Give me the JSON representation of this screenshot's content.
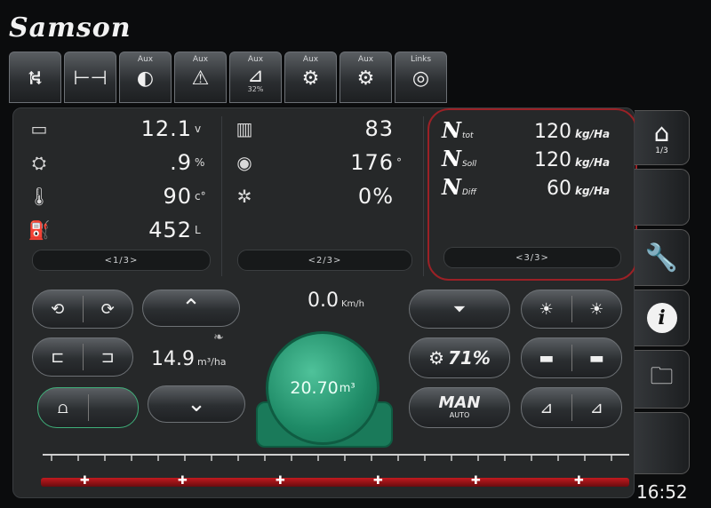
{
  "brand": "Samson",
  "tabs": [
    {
      "label": "",
      "icon": "lever-icon",
      "glyph": "⛕",
      "sub": ""
    },
    {
      "label": "",
      "icon": "axle-icon",
      "glyph": "⊢⊣",
      "sub": ""
    },
    {
      "label": "Aux",
      "icon": "light-icon",
      "glyph": "◐",
      "sub": ""
    },
    {
      "label": "Aux",
      "icon": "beacon-icon",
      "glyph": "⚠",
      "sub": ""
    },
    {
      "label": "Aux",
      "icon": "level-icon",
      "glyph": "⊿",
      "sub": "32%"
    },
    {
      "label": "Aux",
      "icon": "valve-icon",
      "glyph": "⚙",
      "sub": ""
    },
    {
      "label": "Aux",
      "icon": "pump-icon",
      "glyph": "⚙",
      "sub": ""
    },
    {
      "label": "Links",
      "icon": "tyre-icon",
      "glyph": "◎",
      "sub": ""
    }
  ],
  "sec1": {
    "rows": [
      {
        "icon": "battery-icon",
        "glyph": "▭",
        "value": "12.1",
        "unit": "v"
      },
      {
        "icon": "engine-icon",
        "glyph": "⛭",
        "value": ".9",
        "unit": "%"
      },
      {
        "icon": "thermometer-icon",
        "glyph": "🌡",
        "value": "90",
        "unit": "c°"
      },
      {
        "icon": "fuel-icon",
        "glyph": "⛽",
        "value": "452",
        "unit": "L"
      }
    ],
    "pager": "<1/3>"
  },
  "sec2": {
    "rows": [
      {
        "icon": "map-icon",
        "glyph": "▥",
        "value": "83",
        "unit": ""
      },
      {
        "icon": "compass-icon",
        "glyph": "◉",
        "value": "176",
        "unit": "°"
      },
      {
        "icon": "wheel-slip-icon",
        "glyph": "✲",
        "value": "0%",
        "unit": ""
      }
    ],
    "pager": "<2/3>"
  },
  "sec3": {
    "rows": [
      {
        "sub": "tot",
        "value": "120",
        "unit": "kg/Ha"
      },
      {
        "sub": "Soll",
        "value": "120",
        "unit": "kg/Ha"
      },
      {
        "sub": "Diff",
        "value": "60",
        "unit": "kg/Ha"
      }
    ],
    "n": "N",
    "pager": "<3/3>"
  },
  "speed": {
    "value": "0.0",
    "unit": "Km/h"
  },
  "rate": {
    "value": "14.9",
    "unit": "m³/ha"
  },
  "tank": {
    "value": "20.70",
    "unit": "m³"
  },
  "controls": {
    "up": "⌃",
    "down": "⌄",
    "pump_pct": "71%",
    "man": "MAN",
    "auto": "AUTO"
  },
  "side": {
    "home_sub": "1/3"
  },
  "clock": "16:52",
  "colors": {
    "accent_red": "#9b2126",
    "tank_green": "#1e8a66"
  }
}
